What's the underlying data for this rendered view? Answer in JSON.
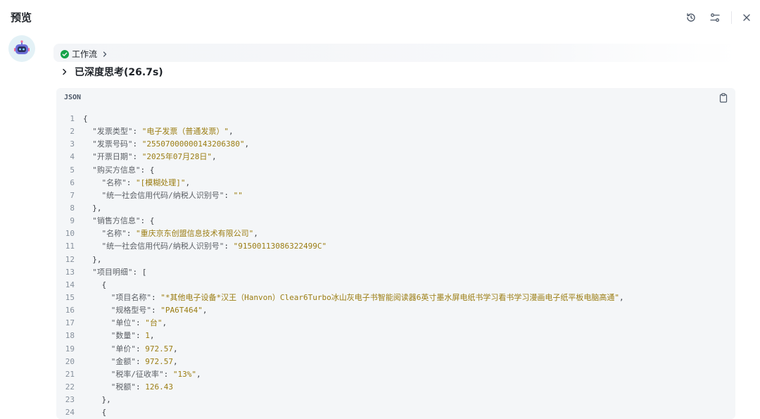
{
  "header": {
    "title": "预览",
    "icons": [
      "history-icon",
      "settings-icon",
      "close-icon"
    ]
  },
  "assistant": {
    "avatar_icon": "robot-avatar-icon",
    "workflow_label": "工作流",
    "thinking_label": "已深度思考(26.7s)"
  },
  "code_block": {
    "language": "JSON",
    "copy_icon": "clipboard-icon",
    "lines": [
      {
        "n": "1",
        "parts": [
          [
            "p",
            "{"
          ]
        ]
      },
      {
        "n": "2",
        "parts": [
          [
            "p",
            "  "
          ],
          [
            "k",
            "\"发票类型\""
          ],
          [
            "p",
            ": "
          ],
          [
            "s",
            "\"电子发票（普通发票）\""
          ],
          [
            "p",
            ","
          ]
        ]
      },
      {
        "n": "3",
        "parts": [
          [
            "p",
            "  "
          ],
          [
            "k",
            "\"发票号码\""
          ],
          [
            "p",
            ": "
          ],
          [
            "s",
            "\"25507000000143206380\""
          ],
          [
            "p",
            ","
          ]
        ]
      },
      {
        "n": "4",
        "parts": [
          [
            "p",
            "  "
          ],
          [
            "k",
            "\"开票日期\""
          ],
          [
            "p",
            ": "
          ],
          [
            "s",
            "\"2025年07月28日\""
          ],
          [
            "p",
            ","
          ]
        ]
      },
      {
        "n": "5",
        "parts": [
          [
            "p",
            "  "
          ],
          [
            "k",
            "\"购买方信息\""
          ],
          [
            "p",
            ": {"
          ]
        ]
      },
      {
        "n": "6",
        "parts": [
          [
            "p",
            "    "
          ],
          [
            "k",
            "\"名称\""
          ],
          [
            "p",
            ": "
          ],
          [
            "s",
            "\"[模糊处理]\""
          ],
          [
            "p",
            ","
          ]
        ]
      },
      {
        "n": "7",
        "parts": [
          [
            "p",
            "    "
          ],
          [
            "k",
            "\"统一社会信用代码/纳税人识别号\""
          ],
          [
            "p",
            ": "
          ],
          [
            "s",
            "\"\""
          ]
        ]
      },
      {
        "n": "8",
        "parts": [
          [
            "p",
            "  },"
          ]
        ]
      },
      {
        "n": "9",
        "parts": [
          [
            "p",
            "  "
          ],
          [
            "k",
            "\"销售方信息\""
          ],
          [
            "p",
            ": {"
          ]
        ]
      },
      {
        "n": "10",
        "parts": [
          [
            "p",
            "    "
          ],
          [
            "k",
            "\"名称\""
          ],
          [
            "p",
            ": "
          ],
          [
            "s",
            "\"重庆京东创盟信息技术有限公司\""
          ],
          [
            "p",
            ","
          ]
        ]
      },
      {
        "n": "11",
        "parts": [
          [
            "p",
            "    "
          ],
          [
            "k",
            "\"统一社会信用代码/纳税人识别号\""
          ],
          [
            "p",
            ": "
          ],
          [
            "s",
            "\"91500113086322499C\""
          ]
        ]
      },
      {
        "n": "12",
        "parts": [
          [
            "p",
            "  },"
          ]
        ]
      },
      {
        "n": "13",
        "parts": [
          [
            "p",
            "  "
          ],
          [
            "k",
            "\"项目明细\""
          ],
          [
            "p",
            ": ["
          ]
        ]
      },
      {
        "n": "14",
        "parts": [
          [
            "p",
            "    {"
          ]
        ]
      },
      {
        "n": "15",
        "parts": [
          [
            "p",
            "      "
          ],
          [
            "k",
            "\"项目名称\""
          ],
          [
            "p",
            ": "
          ],
          [
            "s",
            "\"*其他电子设备*汉王（Hanvon）Clear6Turbo冰山灰电子书智能阅读器6英寸墨水屏电纸书学习看书学习漫画电子纸平板电脑高通\""
          ],
          [
            "p",
            ","
          ]
        ]
      },
      {
        "n": "16",
        "parts": [
          [
            "p",
            "      "
          ],
          [
            "k",
            "\"规格型号\""
          ],
          [
            "p",
            ": "
          ],
          [
            "s",
            "\"PA6T464\""
          ],
          [
            "p",
            ","
          ]
        ]
      },
      {
        "n": "17",
        "parts": [
          [
            "p",
            "      "
          ],
          [
            "k",
            "\"单位\""
          ],
          [
            "p",
            ": "
          ],
          [
            "s",
            "\"台\""
          ],
          [
            "p",
            ","
          ]
        ]
      },
      {
        "n": "18",
        "parts": [
          [
            "p",
            "      "
          ],
          [
            "k",
            "\"数量\""
          ],
          [
            "p",
            ": "
          ],
          [
            "n",
            "1"
          ],
          [
            "p",
            ","
          ]
        ]
      },
      {
        "n": "19",
        "parts": [
          [
            "p",
            "      "
          ],
          [
            "k",
            "\"单价\""
          ],
          [
            "p",
            ": "
          ],
          [
            "n",
            "972.57"
          ],
          [
            "p",
            ","
          ]
        ]
      },
      {
        "n": "20",
        "parts": [
          [
            "p",
            "      "
          ],
          [
            "k",
            "\"金额\""
          ],
          [
            "p",
            ": "
          ],
          [
            "n",
            "972.57"
          ],
          [
            "p",
            ","
          ]
        ]
      },
      {
        "n": "21",
        "parts": [
          [
            "p",
            "      "
          ],
          [
            "k",
            "\"税率/征收率\""
          ],
          [
            "p",
            ": "
          ],
          [
            "s",
            "\"13%\""
          ],
          [
            "p",
            ","
          ]
        ]
      },
      {
        "n": "22",
        "parts": [
          [
            "p",
            "      "
          ],
          [
            "k",
            "\"税额\""
          ],
          [
            "p",
            ": "
          ],
          [
            "n",
            "126.43"
          ]
        ]
      },
      {
        "n": "23",
        "parts": [
          [
            "p",
            "    },"
          ]
        ]
      },
      {
        "n": "24",
        "parts": [
          [
            "p",
            "    {"
          ]
        ]
      }
    ]
  }
}
